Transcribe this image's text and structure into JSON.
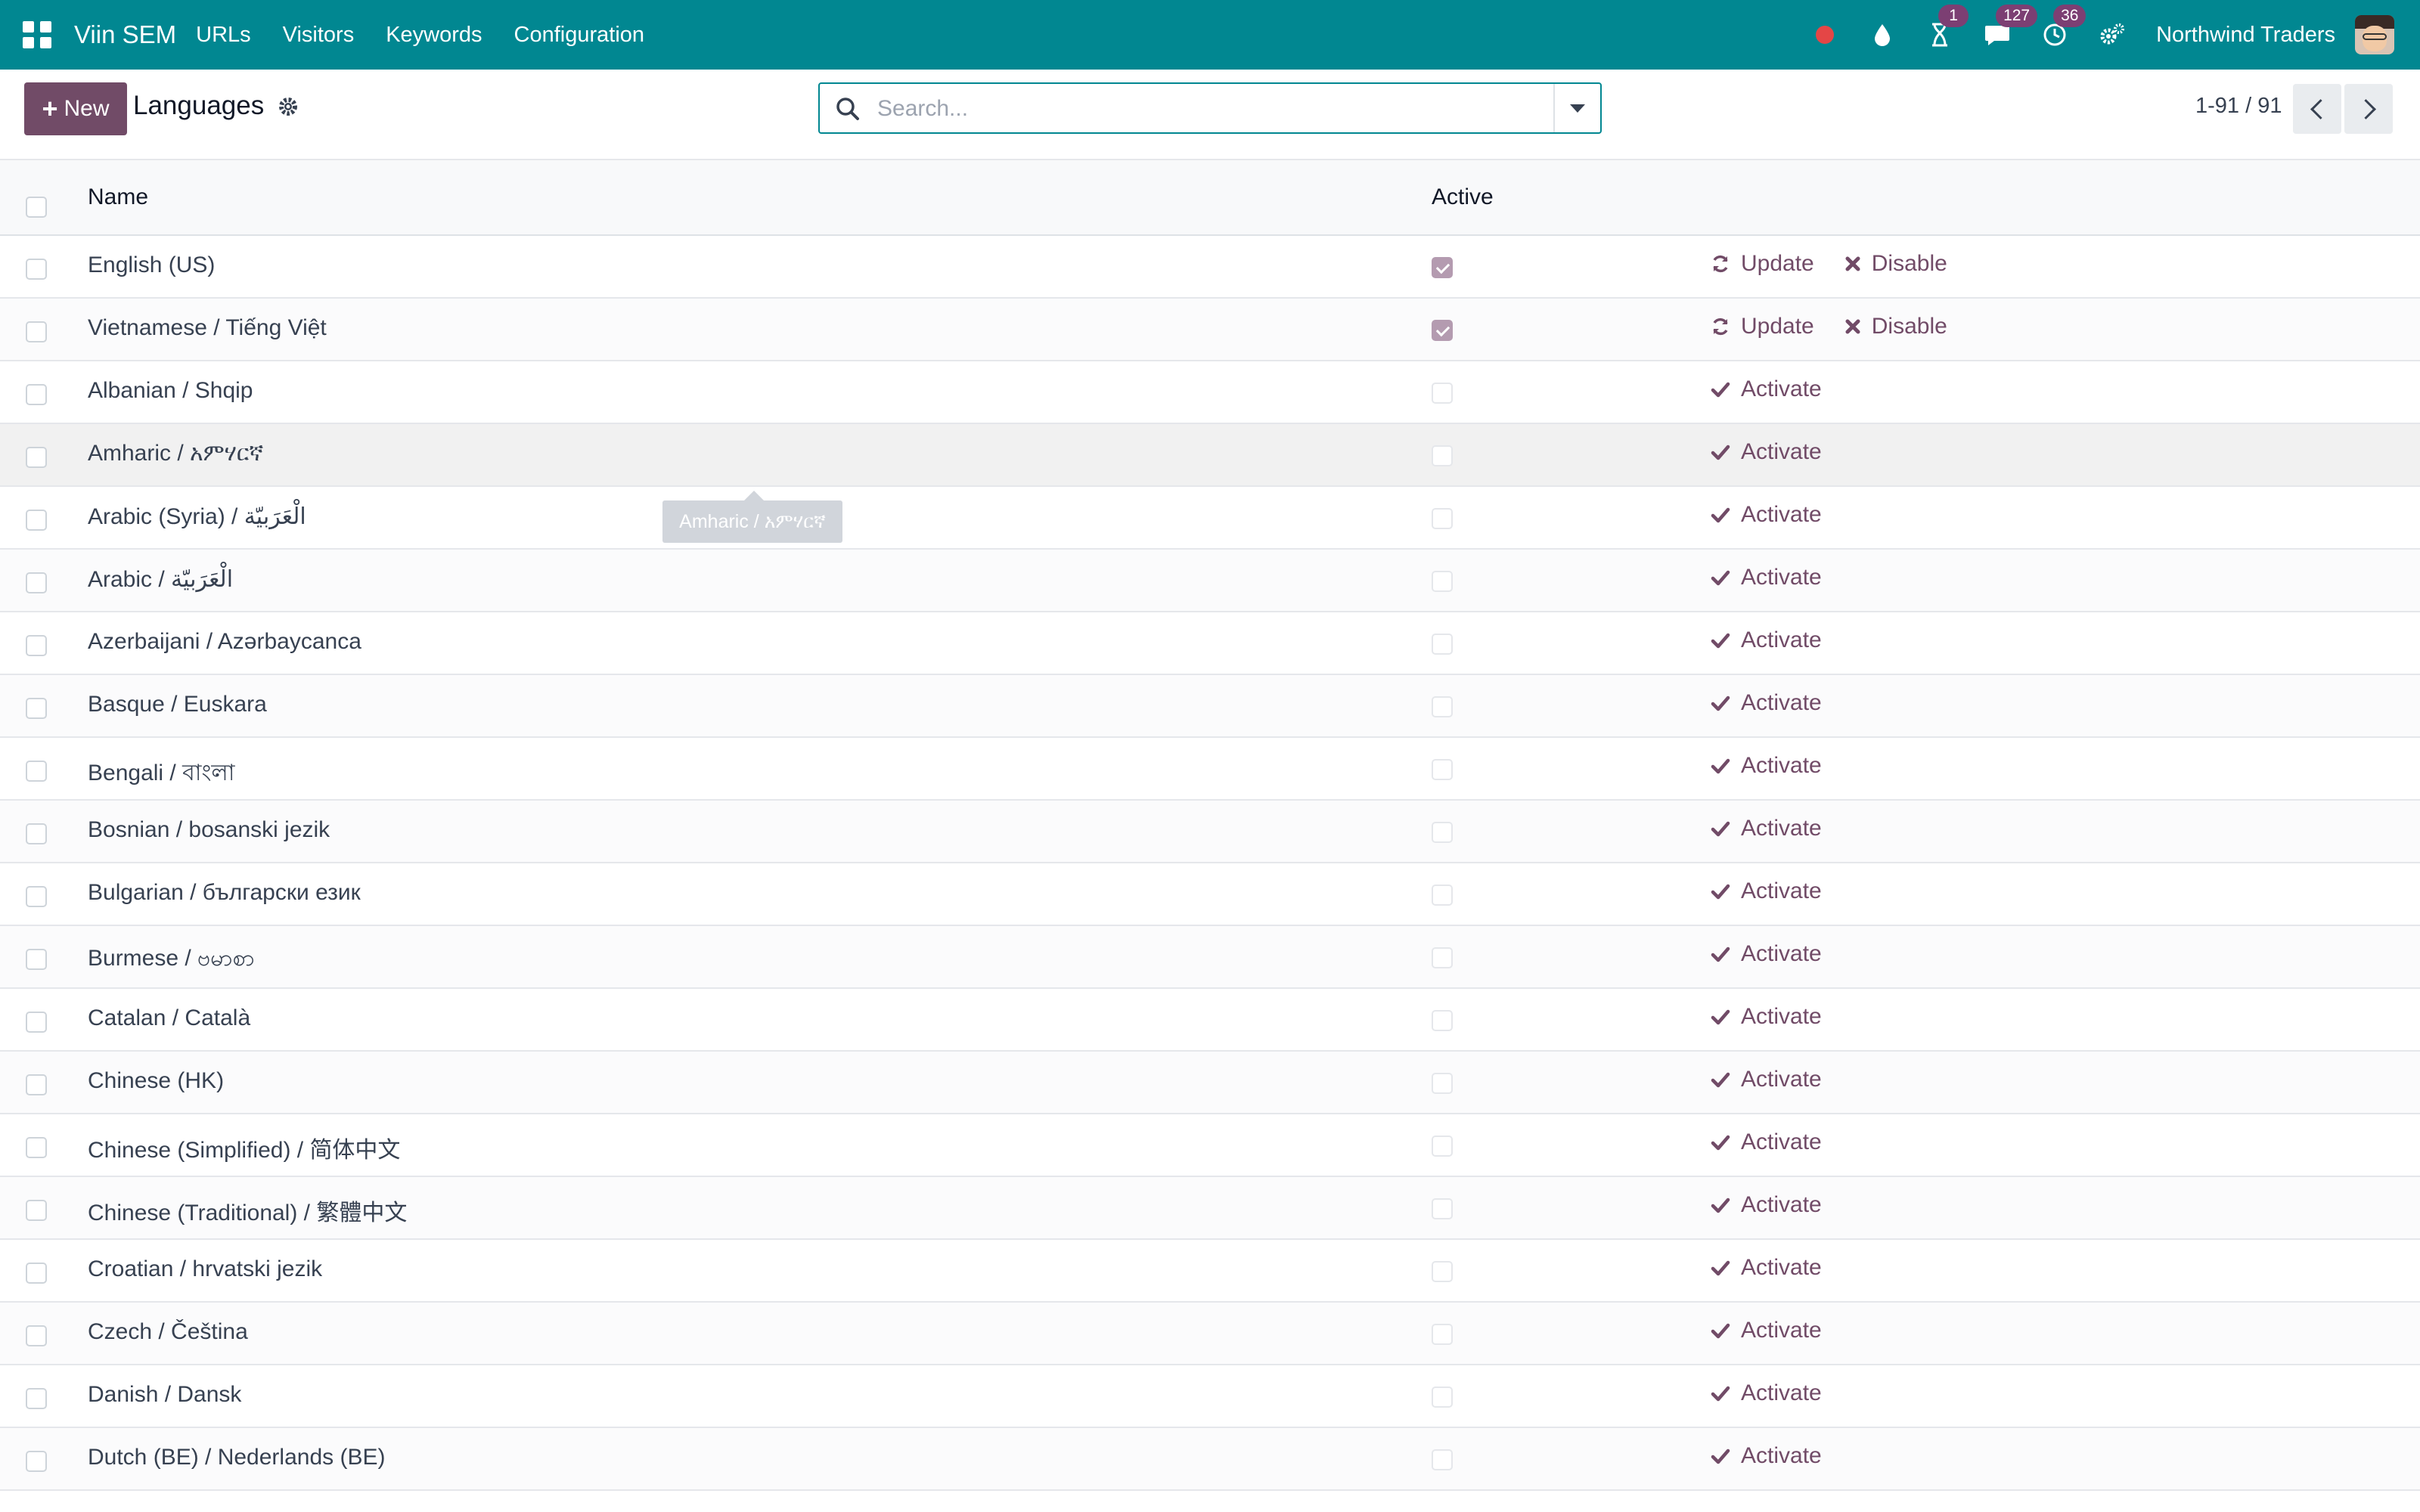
{
  "navbar": {
    "brand": "Viin SEM",
    "menus": [
      "URLs",
      "Visitors",
      "Keywords",
      "Configuration"
    ],
    "badges": {
      "activities": "1",
      "messages": "127",
      "updates": "36"
    },
    "company": "Northwind Traders"
  },
  "control": {
    "new_label": "New",
    "title": "Languages",
    "search_placeholder": "Search...",
    "pager": "1-91 / 91"
  },
  "table": {
    "headers": {
      "name": "Name",
      "active": "Active"
    },
    "rows": [
      {
        "name": "English (US)",
        "active": true,
        "actions": [
          "Update",
          "Disable"
        ]
      },
      {
        "name": "Vietnamese / Tiếng Việt",
        "active": true,
        "actions": [
          "Update",
          "Disable"
        ]
      },
      {
        "name": "Albanian / Shqip",
        "active": false,
        "actions": [
          "Activate"
        ]
      },
      {
        "name": "Amharic / አምሃርኛ",
        "active": false,
        "actions": [
          "Activate"
        ]
      },
      {
        "name": "Arabic (Syria) / الْعَرَبيّة",
        "active": false,
        "actions": [
          "Activate"
        ]
      },
      {
        "name": "Arabic / الْعَرَبيّة",
        "active": false,
        "actions": [
          "Activate"
        ]
      },
      {
        "name": "Azerbaijani / Azərbaycanca",
        "active": false,
        "actions": [
          "Activate"
        ]
      },
      {
        "name": "Basque / Euskara",
        "active": false,
        "actions": [
          "Activate"
        ]
      },
      {
        "name": "Bengali / বাংলা",
        "active": false,
        "actions": [
          "Activate"
        ]
      },
      {
        "name": "Bosnian / bosanski jezik",
        "active": false,
        "actions": [
          "Activate"
        ]
      },
      {
        "name": "Bulgarian / български език",
        "active": false,
        "actions": [
          "Activate"
        ]
      },
      {
        "name": "Burmese / ဗမာစာ",
        "active": false,
        "actions": [
          "Activate"
        ]
      },
      {
        "name": "Catalan / Català",
        "active": false,
        "actions": [
          "Activate"
        ]
      },
      {
        "name": "Chinese (HK)",
        "active": false,
        "actions": [
          "Activate"
        ]
      },
      {
        "name": "Chinese (Simplified) / 简体中文",
        "active": false,
        "actions": [
          "Activate"
        ]
      },
      {
        "name": "Chinese (Traditional) / 繁體中文",
        "active": false,
        "actions": [
          "Activate"
        ]
      },
      {
        "name": "Croatian / hrvatski jezik",
        "active": false,
        "actions": [
          "Activate"
        ]
      },
      {
        "name": "Czech / Čeština",
        "active": false,
        "actions": [
          "Activate"
        ]
      },
      {
        "name": "Danish / Dansk",
        "active": false,
        "actions": [
          "Activate"
        ]
      },
      {
        "name": "Dutch (BE) / Nederlands (BE)",
        "active": false,
        "actions": [
          "Activate"
        ]
      }
    ]
  },
  "tooltip": "Amharic / አምሃርኛ",
  "colors": {
    "navbar": "#018791",
    "primary": "#714b67",
    "badge": "#7c3f73"
  }
}
